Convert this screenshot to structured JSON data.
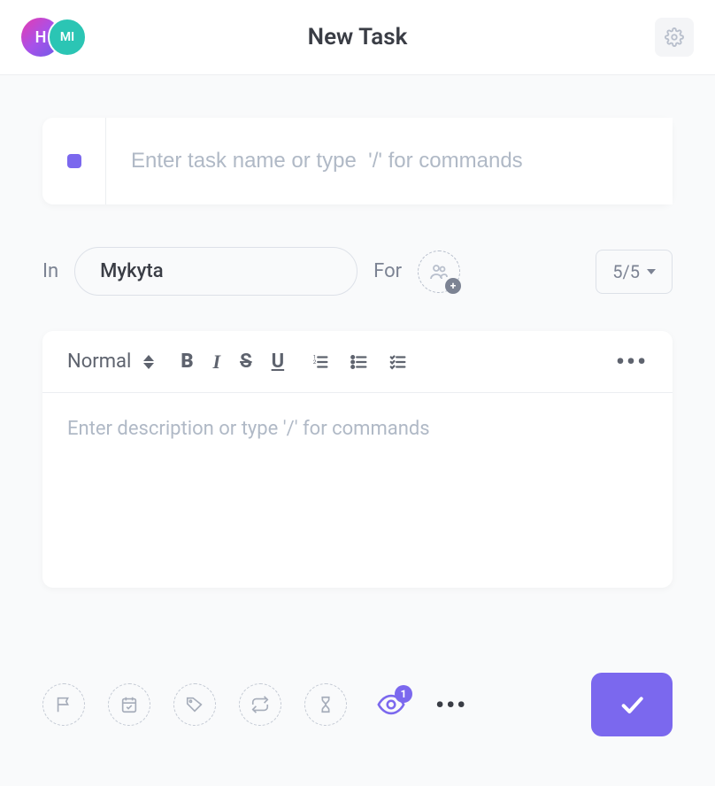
{
  "header": {
    "avatars": [
      "H",
      "MI"
    ],
    "title": "New Task"
  },
  "task": {
    "name_placeholder": "Enter task name or type  '/' for commands",
    "in_label": "In",
    "list_value": "Mykyta",
    "for_label": "For",
    "priority_value": "5/5"
  },
  "editor": {
    "format": "Normal",
    "placeholder": "Enter description or type '/' for commands"
  },
  "footer": {
    "watcher_count": "1"
  }
}
